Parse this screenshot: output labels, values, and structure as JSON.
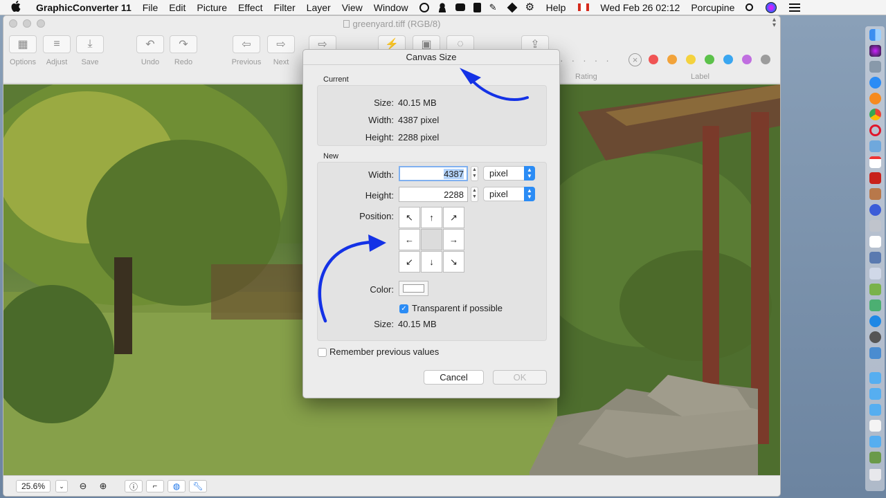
{
  "menubar": {
    "apple": "",
    "app_name": "GraphicConverter 11",
    "menus": [
      "File",
      "Edit",
      "Picture",
      "Effect",
      "Filter",
      "Layer",
      "View",
      "Window"
    ],
    "help": "Help",
    "datetime": "Wed Feb 26  02:12",
    "username": "Porcupine"
  },
  "window": {
    "title": "greenyard.tiff (RGB/8)",
    "toolbar": {
      "options": "Options",
      "adjust": "Adjust",
      "save": "Save",
      "undo": "Undo",
      "redo": "Redo",
      "previous": "Previous",
      "next": "Next",
      "rating": "Rating",
      "label": "Label",
      "rating_dots": "· · · · ·"
    },
    "label_colors": [
      "#f05454",
      "#f2a33a",
      "#f4d23e",
      "#5cc14a",
      "#3aa6f0",
      "#c06ee0",
      "#9c9c9c"
    ],
    "statusbar": {
      "zoom": "25.6%"
    }
  },
  "dialog": {
    "title": "Canvas Size",
    "current": {
      "heading": "Current",
      "size_label": "Size:",
      "size_value": "40.15 MB",
      "width_label": "Width:",
      "width_value": "4387 pixel",
      "height_label": "Height:",
      "height_value": "2288 pixel"
    },
    "new": {
      "heading": "New",
      "width_label": "Width:",
      "width_value": "4387",
      "width_unit": "pixel",
      "height_label": "Height:",
      "height_value": "2288",
      "height_unit": "pixel",
      "position_label": "Position:",
      "position_arrows": [
        "↖",
        "↑",
        "↗",
        "←",
        "",
        "→",
        "↙",
        "↓",
        "↘"
      ],
      "color_label": "Color:",
      "transparent_label": "Transparent if possible",
      "transparent_checked": true,
      "size_label": "Size:",
      "size_value": "40.15 MB"
    },
    "remember_label": "Remember previous values",
    "remember_checked": false,
    "cancel": "Cancel",
    "ok": "OK"
  }
}
